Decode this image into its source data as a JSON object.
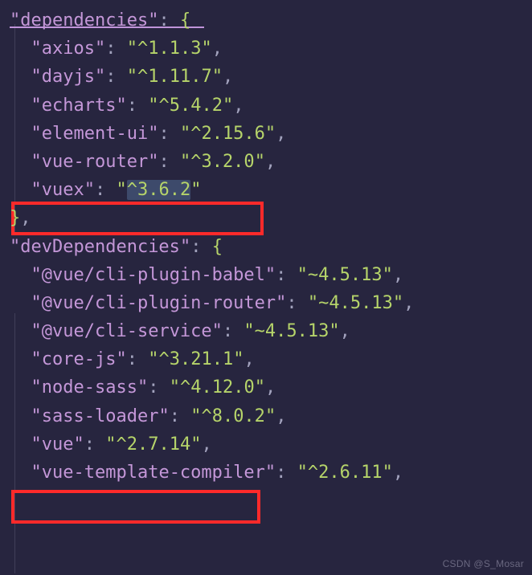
{
  "dependencies_label": "dependencies",
  "dependencies": [
    {
      "key": "axios",
      "value": "^1.1.3"
    },
    {
      "key": "dayjs",
      "value": "^1.11.7"
    },
    {
      "key": "echarts",
      "value": "^5.4.2"
    },
    {
      "key": "element-ui",
      "value": "^2.15.6"
    },
    {
      "key": "vue-router",
      "value": "^3.2.0"
    },
    {
      "key": "vuex",
      "value": "^3.6.2"
    }
  ],
  "devDependencies_label": "devDependencies",
  "devDependencies": [
    {
      "key": "@vue/cli-plugin-babel",
      "value": "~4.5.13"
    },
    {
      "key": "@vue/cli-plugin-router",
      "value": "~4.5.13"
    },
    {
      "key": "@vue/cli-service",
      "value": "~4.5.13"
    },
    {
      "key": "core-js",
      "value": "^3.21.1"
    },
    {
      "key": "node-sass",
      "value": "^4.12.0"
    },
    {
      "key": "sass-loader",
      "value": "^8.0.2"
    },
    {
      "key": "vue",
      "value": "^2.7.14"
    },
    {
      "key": "vue-template-compiler",
      "value": "^2.6.11"
    }
  ],
  "watermark": "CSDN @S_Mosar"
}
